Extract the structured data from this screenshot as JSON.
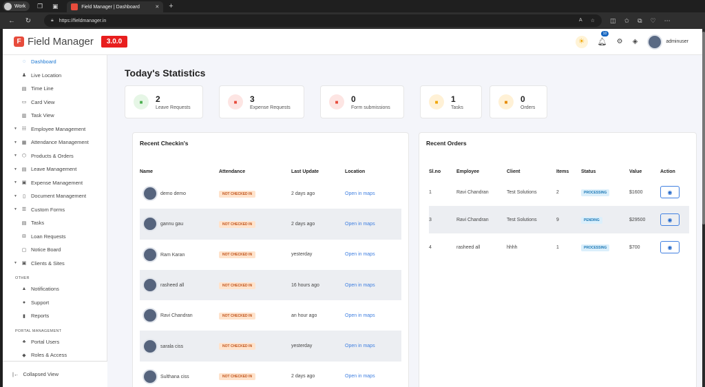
{
  "browser": {
    "profile": "Work",
    "tab_title": "Field Manager | Dashboard",
    "url": "https://fieldmanager.in"
  },
  "header": {
    "app_name": "Field Manager",
    "version": "3.0.0",
    "notif_count": "10",
    "username": "adminuser"
  },
  "sidebar": {
    "items": [
      {
        "label": "Dashboard",
        "icon": "dashboard-icon",
        "caret": false,
        "active": true
      },
      {
        "label": "Live Location",
        "icon": "person-pin-icon",
        "caret": false
      },
      {
        "label": "Time Line",
        "icon": "timeline-icon",
        "caret": false
      },
      {
        "label": "Card View",
        "icon": "card-icon",
        "caret": false
      },
      {
        "label": "Task View",
        "icon": "task-view-icon",
        "caret": false
      },
      {
        "label": "Employee Management",
        "icon": "employee-icon",
        "caret": true
      },
      {
        "label": "Attendance Management",
        "icon": "calendar-icon",
        "caret": true
      },
      {
        "label": "Products & Orders",
        "icon": "box-icon",
        "caret": true
      },
      {
        "label": "Leave Management",
        "icon": "leave-icon",
        "caret": true
      },
      {
        "label": "Expense Management",
        "icon": "expense-icon",
        "caret": true
      },
      {
        "label": "Document Management",
        "icon": "document-icon",
        "caret": true
      },
      {
        "label": "Custom Forms",
        "icon": "form-icon",
        "caret": true
      },
      {
        "label": "Tasks",
        "icon": "tasks-icon",
        "caret": false
      },
      {
        "label": "Loan Requests",
        "icon": "loan-icon",
        "caret": false
      },
      {
        "label": "Notice Board",
        "icon": "notice-icon",
        "caret": false
      },
      {
        "label": "Clients & Sites",
        "icon": "clients-icon",
        "caret": true
      }
    ],
    "other_title": "OTHER",
    "other_items": [
      {
        "label": "Notifications",
        "icon": "bell-icon"
      },
      {
        "label": "Support",
        "icon": "info-icon"
      },
      {
        "label": "Reports",
        "icon": "report-icon"
      }
    ],
    "portal_title": "PORTAL MANAGEMENT",
    "portal_items": [
      {
        "label": "Portal Users",
        "icon": "users-icon"
      },
      {
        "label": "Roles & Access",
        "icon": "roles-icon"
      }
    ],
    "collapse_label": "Collapsed View"
  },
  "main": {
    "title": "Today's Statistics",
    "stats": [
      {
        "value": "2",
        "label": "Leave Requests",
        "color": "#4caf50",
        "bg": "#e6f6e6"
      },
      {
        "value": "3",
        "label": "Expense Requests",
        "color": "#e74c3c",
        "bg": "#fde5e3"
      },
      {
        "value": "0",
        "label": "Form submissions",
        "color": "#e74c3c",
        "bg": "#fde5e3"
      },
      {
        "value": "1",
        "label": "Tasks",
        "color": "#f0a500",
        "bg": "#fff1d6"
      },
      {
        "value": "0",
        "label": "Orders",
        "color": "#e68a00",
        "bg": "#fff1d6"
      }
    ],
    "checkin": {
      "title": "Recent Checkin's",
      "headers": [
        "Name",
        "Attendance",
        "Last Update",
        "Location"
      ],
      "rows": [
        {
          "name": "demo demo",
          "status": "NOT CHECKED IN",
          "update": "2 days ago",
          "loc": "Open in maps"
        },
        {
          "name": "gannu gau",
          "status": "NOT CHECKED IN",
          "update": "2 days ago",
          "loc": "Open in maps"
        },
        {
          "name": "Ram Karan",
          "status": "NOT CHECKED IN",
          "update": "yesterday",
          "loc": "Open in maps"
        },
        {
          "name": "rasheed all",
          "status": "NOT CHECKED IN",
          "update": "16 hours ago",
          "loc": "Open in maps"
        },
        {
          "name": "Ravi Chandran",
          "status": "NOT CHECKED IN",
          "update": "an hour ago",
          "loc": "Open in maps"
        },
        {
          "name": "sarala ciss",
          "status": "NOT CHECKED IN",
          "update": "yesterday",
          "loc": "Open in maps"
        },
        {
          "name": "Sulthana ciss",
          "status": "NOT CHECKED IN",
          "update": "2 days ago",
          "loc": "Open in maps"
        }
      ]
    },
    "orders": {
      "title": "Recent Orders",
      "headers": [
        "Sl.no",
        "Employee",
        "Client",
        "Items",
        "Status",
        "Value",
        "Action"
      ],
      "rows": [
        {
          "sl": "1",
          "emp": "Ravi Chandran",
          "client": "Test Solutions",
          "items": "2",
          "status": "PROCESSING",
          "value": "$1600"
        },
        {
          "sl": "3",
          "emp": "Ravi Chandran",
          "client": "Test Solutions",
          "items": "9",
          "status": "PENDING",
          "value": "$29500"
        },
        {
          "sl": "4",
          "emp": "rasheed all",
          "client": "hhhh",
          "items": "1",
          "status": "PROCESSING",
          "value": "$700"
        }
      ]
    }
  }
}
